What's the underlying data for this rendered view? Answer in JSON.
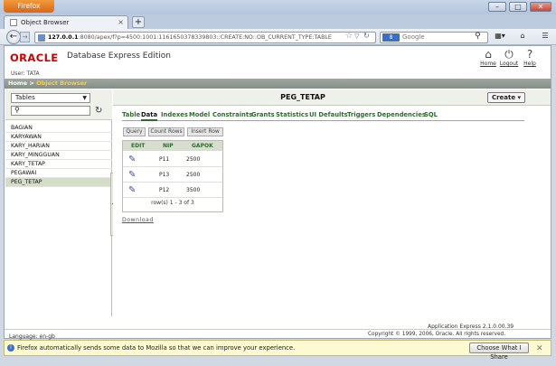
{
  "browser": {
    "menu_button": "Firefox",
    "tab_title": "Object Browser",
    "new_tab": "+",
    "url_host": "127.0.0.1",
    "url_rest": ":8080/apex/f?p=4500:1001:1161650378339803::CREATE:NO::OB_CURRENT_TYPE:TABLE",
    "search_placeholder": "Google",
    "search_engine": "8",
    "window_controls": [
      "–",
      "□",
      "✕"
    ]
  },
  "header": {
    "brand": "ORACLE",
    "product": "Database Express Edition",
    "user": "User: TATA",
    "links": [
      {
        "label": "Home",
        "icon": "home-icon",
        "glyph": "⌂"
      },
      {
        "label": "Logout",
        "icon": "power-icon",
        "glyph": "⏻"
      },
      {
        "label": "Help",
        "icon": "help-icon",
        "glyph": "?"
      }
    ]
  },
  "breadcrumb": {
    "home": "Home",
    "sep": " > ",
    "current": "Object Browser"
  },
  "left": {
    "object_type": "Tables",
    "tables": [
      "BAGIAN",
      "KARYAWAN",
      "KARY_HARIAN",
      "KARY_MINGGUAN",
      "KARY_TETAP",
      "PEGAWAI",
      "PEG_TETAP"
    ],
    "selected_index": 6
  },
  "object": {
    "name": "PEG_TETAP",
    "create_label": "Create",
    "tabs": [
      "Table",
      "Data",
      "Indexes",
      "Model",
      "Constraints",
      "Grants",
      "Statistics",
      "UI Defaults",
      "Triggers",
      "Dependencies",
      "SQL"
    ],
    "active_tab": "Data",
    "sub_buttons": [
      "Query",
      "Count Rows",
      "Insert Row"
    ],
    "columns": [
      "EDIT",
      "NIP",
      "GAPOK"
    ],
    "rows": [
      {
        "nip": "P11",
        "gapok": "2500"
      },
      {
        "nip": "P13",
        "gapok": "2500"
      },
      {
        "nip": "P12",
        "gapok": "3500"
      }
    ],
    "row_count": "row(s) 1 - 3 of 3",
    "download": "Download"
  },
  "footer": {
    "language": "Language: en-gb",
    "version": "Application Express 2.1.0.00.39",
    "copyright": "Copyright © 1999, 2006, Oracle. All rights reserved."
  },
  "notification": {
    "text": "Firefox automatically sends some data to Mozilla so that we can improve your experience.",
    "button": "Choose What I Share",
    "close": "✕"
  }
}
